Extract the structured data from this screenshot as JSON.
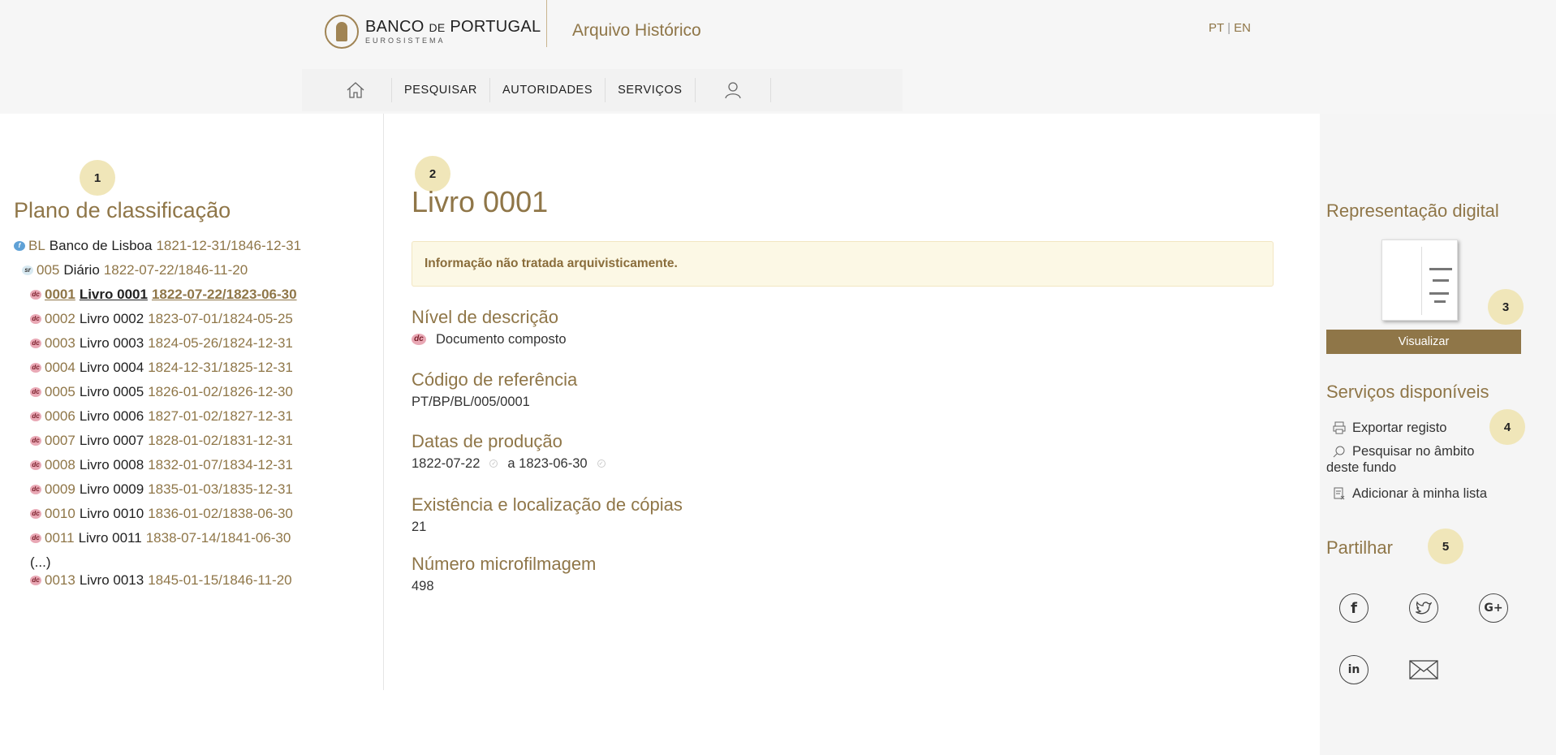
{
  "header": {
    "logo_name_1": "BANCO",
    "logo_name_2": "DE",
    "logo_name_3": "PORTUGAL",
    "logo_sub": "EUROSISTEMA",
    "site_title": "Arquivo Histórico",
    "lang_pt": "PT",
    "lang_sep": "|",
    "lang_en": "EN"
  },
  "nav": {
    "home_icon": "home-icon",
    "items": [
      "PESQUISAR",
      "AUTORIDADES",
      "SERVIÇOS"
    ],
    "user_icon": "user-icon"
  },
  "badges": [
    "1",
    "2",
    "3",
    "4",
    "5"
  ],
  "left": {
    "title": "Plano de classificação",
    "tree": [
      {
        "icon": "f",
        "code": "BL",
        "name": "Banco de Lisboa",
        "dates": "1821-12-31/1846-12-31"
      },
      {
        "icon": "sr",
        "code": "005",
        "name": "Diário",
        "dates": "1822-07-22/1846-11-20"
      },
      {
        "icon": "dc",
        "code": "0001",
        "name": "Livro 0001",
        "dates": "1822-07-22/1823-06-30"
      },
      {
        "icon": "dc",
        "code": "0002",
        "name": "Livro 0002",
        "dates": "1823-07-01/1824-05-25"
      },
      {
        "icon": "dc",
        "code": "0003",
        "name": "Livro 0003",
        "dates": "1824-05-26/1824-12-31"
      },
      {
        "icon": "dc",
        "code": "0004",
        "name": "Livro 0004",
        "dates": "1824-12-31/1825-12-31"
      },
      {
        "icon": "dc",
        "code": "0005",
        "name": "Livro 0005",
        "dates": "1826-01-02/1826-12-30"
      },
      {
        "icon": "dc",
        "code": "0006",
        "name": "Livro 0006",
        "dates": "1827-01-02/1827-12-31"
      },
      {
        "icon": "dc",
        "code": "0007",
        "name": "Livro 0007",
        "dates": "1828-01-02/1831-12-31"
      },
      {
        "icon": "dc",
        "code": "0008",
        "name": "Livro 0008",
        "dates": "1832-01-07/1834-12-31"
      },
      {
        "icon": "dc",
        "code": "0009",
        "name": "Livro 0009",
        "dates": "1835-01-03/1835-12-31"
      },
      {
        "icon": "dc",
        "code": "0010",
        "name": "Livro 0010",
        "dates": "1836-01-02/1838-06-30"
      },
      {
        "icon": "dc",
        "code": "0011",
        "name": "Livro 0011",
        "dates": "1838-07-14/1841-06-30"
      }
    ],
    "ellipsis": "(...)",
    "last": {
      "icon": "dc",
      "code": "0013",
      "name": "Livro 0013",
      "dates": "1845-01-15/1846-11-20"
    }
  },
  "main": {
    "title": "Livro 0001",
    "alert": "Informação não tratada arquivisticamente.",
    "nivel_label": "Nível de descrição",
    "nivel_value": "Documento composto",
    "codigo_label": "Código de referência",
    "codigo_value": "PT/BP/BL/005/0001",
    "datas_label": "Datas de produção",
    "datas_start": "1822-07-22",
    "datas_end": "a 1823-06-30",
    "existencia_label": "Existência e localização de cópias",
    "existencia_value": "21",
    "micro_label": "Número microfilmagem",
    "micro_value": "498"
  },
  "right": {
    "digital_title": "Representação digital",
    "visualizar": "Visualizar",
    "servicos_title": "Serviços disponíveis",
    "exportar": "Exportar registo",
    "pesquisar_1": "Pesquisar no âmbito",
    "pesquisar_2": "deste fundo",
    "adicionar": "Adicionar à minha lista",
    "partilhar_title": "Partilhar",
    "social": [
      "facebook-icon",
      "twitter-icon",
      "google-plus-icon",
      "linkedin-icon",
      "email-icon"
    ]
  },
  "colors": {
    "brand": "#8f7648",
    "badge": "#f0e6b9",
    "alert_bg": "#fcf8e5",
    "alert_text": "#8a6d3b"
  }
}
